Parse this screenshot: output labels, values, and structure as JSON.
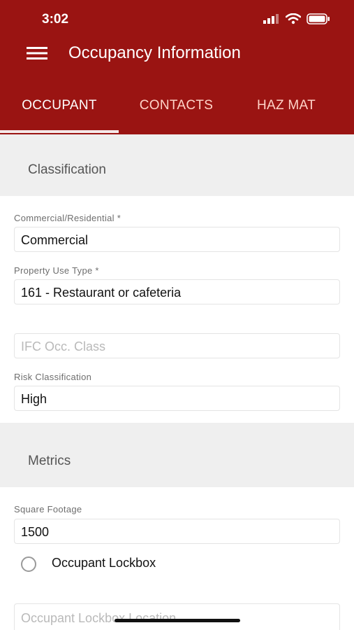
{
  "status": {
    "time": "3:02"
  },
  "header": {
    "title": "Occupancy Information"
  },
  "tabs": [
    {
      "label": "OCCUPANT",
      "active": true
    },
    {
      "label": "CONTACTS",
      "active": false
    },
    {
      "label": "HAZ MAT",
      "active": false
    }
  ],
  "sections": {
    "classification": "Classification",
    "metrics": "Metrics"
  },
  "fields": {
    "commercial_residential": {
      "label": "Commercial/Residential *",
      "value": "Commercial"
    },
    "property_use_type": {
      "label": "Property Use Type *",
      "value": "161 - Restaurant or cafeteria"
    },
    "ifc_occ_class": {
      "placeholder": "IFC Occ. Class"
    },
    "risk_classification": {
      "label": "Risk Classification",
      "value": "High"
    },
    "square_footage": {
      "label": "Square Footage",
      "value": "1500"
    },
    "occupant_lockbox": {
      "label": "Occupant Lockbox",
      "checked": false
    },
    "occupant_lockbox_location": {
      "placeholder": "Occupant Lockbox Location"
    }
  },
  "colors": {
    "primary": "#9a1412",
    "section_bg": "#efefef"
  }
}
